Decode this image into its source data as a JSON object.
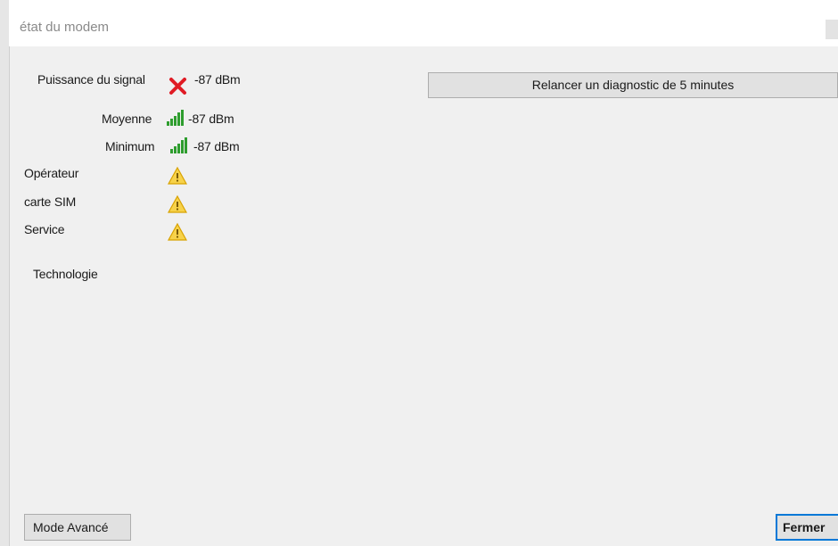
{
  "window": {
    "title": "état du modem"
  },
  "signal": {
    "label": "Puissance du signal",
    "value": "-87 dBm",
    "status_icon": "error-x-icon"
  },
  "average": {
    "label": "Moyenne",
    "value": "-87 dBm",
    "status_icon": "signal-bars-icon"
  },
  "minimum": {
    "label": "Minimum",
    "value": "-87 dBm",
    "status_icon": "signal-bars-icon"
  },
  "operator": {
    "label": "Opérateur",
    "status_icon": "warning-icon"
  },
  "sim": {
    "label": "carte SIM",
    "status_icon": "warning-icon"
  },
  "service": {
    "label": "Service",
    "status_icon": "warning-icon"
  },
  "technology": {
    "label": "Technologie"
  },
  "buttons": {
    "diagnostic": "Relancer un diagnostic de 5 minutes",
    "advanced_mode": "Mode Avancé",
    "close": "Fermer"
  },
  "colors": {
    "error": "#e01b24",
    "signal_green": "#2e9d2e",
    "warning_fill": "#f7d24a",
    "warning_border": "#d8a200",
    "focus_border": "#0078d7"
  }
}
